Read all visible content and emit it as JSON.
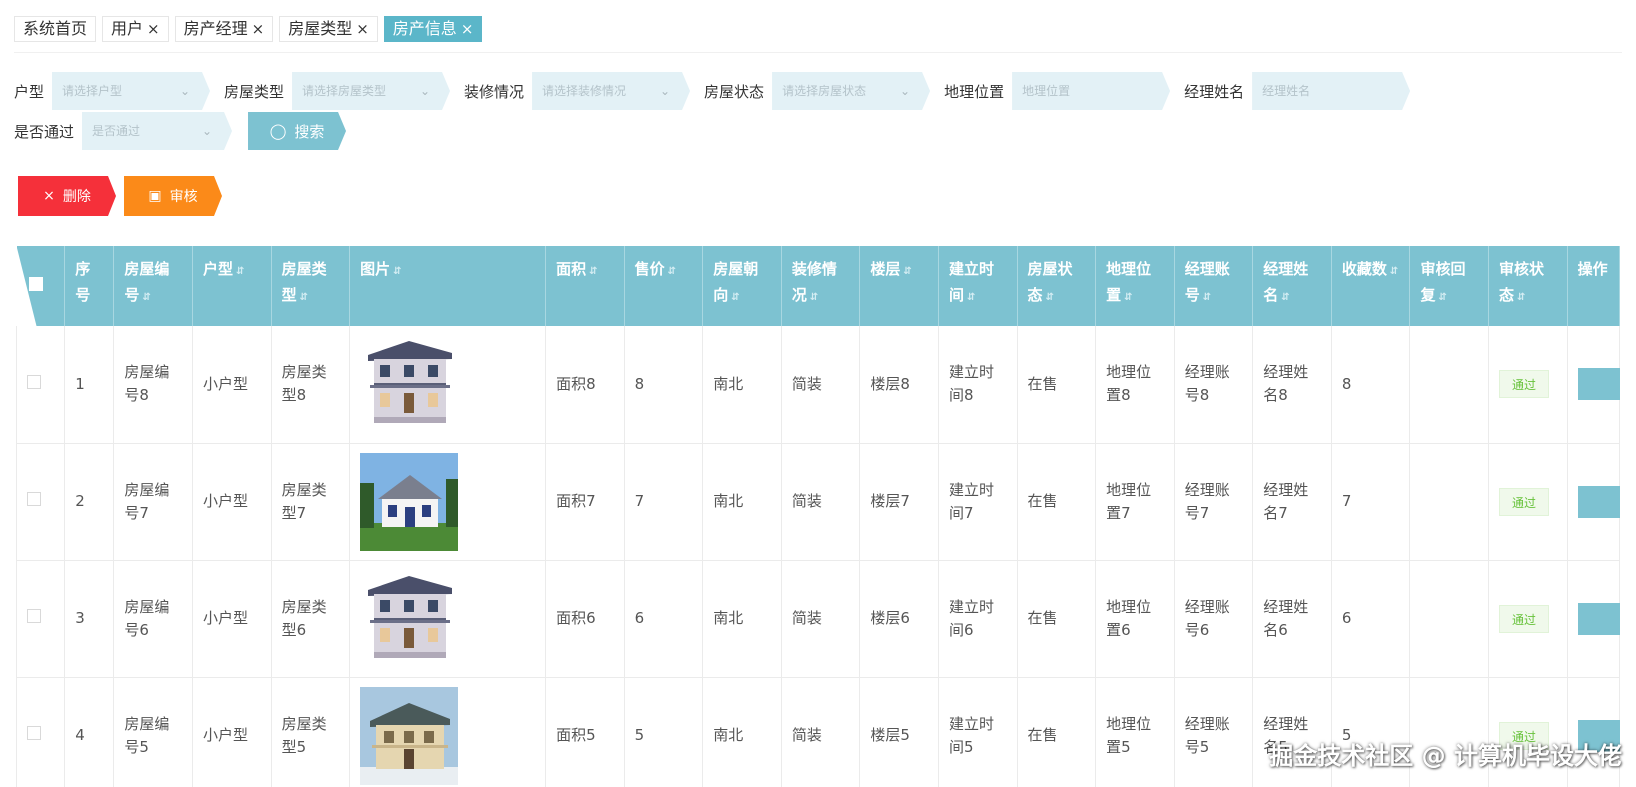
{
  "tabs": [
    {
      "label": "系统首页",
      "closable": false,
      "active": false
    },
    {
      "label": "用户",
      "closable": true,
      "active": false
    },
    {
      "label": "房产经理",
      "closable": true,
      "active": false
    },
    {
      "label": "房屋类型",
      "closable": true,
      "active": false
    },
    {
      "label": "房产信息",
      "closable": true,
      "active": true
    }
  ],
  "close_glyph": "×",
  "filters": {
    "huxing": {
      "label": "户型",
      "placeholder": "请选择户型"
    },
    "leixing": {
      "label": "房屋类型",
      "placeholder": "请选择房屋类型"
    },
    "zhuangxiu": {
      "label": "装修情况",
      "placeholder": "请选择装修情况"
    },
    "zhuangtai": {
      "label": "房屋状态",
      "placeholder": "请选择房屋状态"
    },
    "weizhi": {
      "label": "地理位置",
      "placeholder": "地理位置"
    },
    "jingli": {
      "label": "经理姓名",
      "placeholder": "经理姓名"
    },
    "tongguo": {
      "label": "是否通过",
      "placeholder": "是否通过"
    }
  },
  "search_label": "搜索",
  "actions": {
    "delete_label": "删除",
    "audit_label": "审核"
  },
  "columns": [
    "序号",
    "房屋编号",
    "户型",
    "房屋类型",
    "图片",
    "面积",
    "售价",
    "房屋朝向",
    "装修情况",
    "楼层",
    "建立时间",
    "房屋状态",
    "地理位置",
    "经理账号",
    "经理姓名",
    "收藏数",
    "审核回复",
    "审核状态",
    "操作"
  ],
  "rows": [
    {
      "idx": "1",
      "code": "房屋编号8",
      "huxing": "小户型",
      "type": "房屋类型8",
      "image": "villa-house",
      "area": "面积8",
      "price": "8",
      "orient": "南北",
      "deco": "简装",
      "floor": "楼层8",
      "time": "建立时间8",
      "status": "在售",
      "loc": "地理位置8",
      "acct": "经理账号8",
      "mgr": "经理姓名8",
      "fav": "8",
      "reply": "",
      "audit": "通过"
    },
    {
      "idx": "2",
      "code": "房屋编号7",
      "huxing": "小户型",
      "type": "房屋类型7",
      "image": "cottage-house",
      "area": "面积7",
      "price": "7",
      "orient": "南北",
      "deco": "简装",
      "floor": "楼层7",
      "time": "建立时间7",
      "status": "在售",
      "loc": "地理位置7",
      "acct": "经理账号7",
      "mgr": "经理姓名7",
      "fav": "7",
      "reply": "",
      "audit": "通过"
    },
    {
      "idx": "3",
      "code": "房屋编号6",
      "huxing": "小户型",
      "type": "房屋类型6",
      "image": "villa-house",
      "area": "面积6",
      "price": "6",
      "orient": "南北",
      "deco": "简装",
      "floor": "楼层6",
      "time": "建立时间6",
      "status": "在售",
      "loc": "地理位置6",
      "acct": "经理账号6",
      "mgr": "经理姓名6",
      "fav": "6",
      "reply": "",
      "audit": "通过"
    },
    {
      "idx": "4",
      "code": "房屋编号5",
      "huxing": "小户型",
      "type": "房屋类型5",
      "image": "mansion-house",
      "area": "面积5",
      "price": "5",
      "orient": "南北",
      "deco": "简装",
      "floor": "楼层5",
      "time": "建立时间5",
      "status": "在售",
      "loc": "地理位置5",
      "acct": "经理账号5",
      "mgr": "经理姓名5",
      "fav": "5",
      "reply": "",
      "audit": "通过"
    }
  ],
  "op_glyph": "✓",
  "watermark": "掘金技术社区 @ 计算机毕设大佬",
  "colors": {
    "accent": "#7dc2d1",
    "tab_active": "#5bb6c9",
    "delete": "#f5303a",
    "audit": "#fb8a19",
    "pass": "#67c23a"
  }
}
